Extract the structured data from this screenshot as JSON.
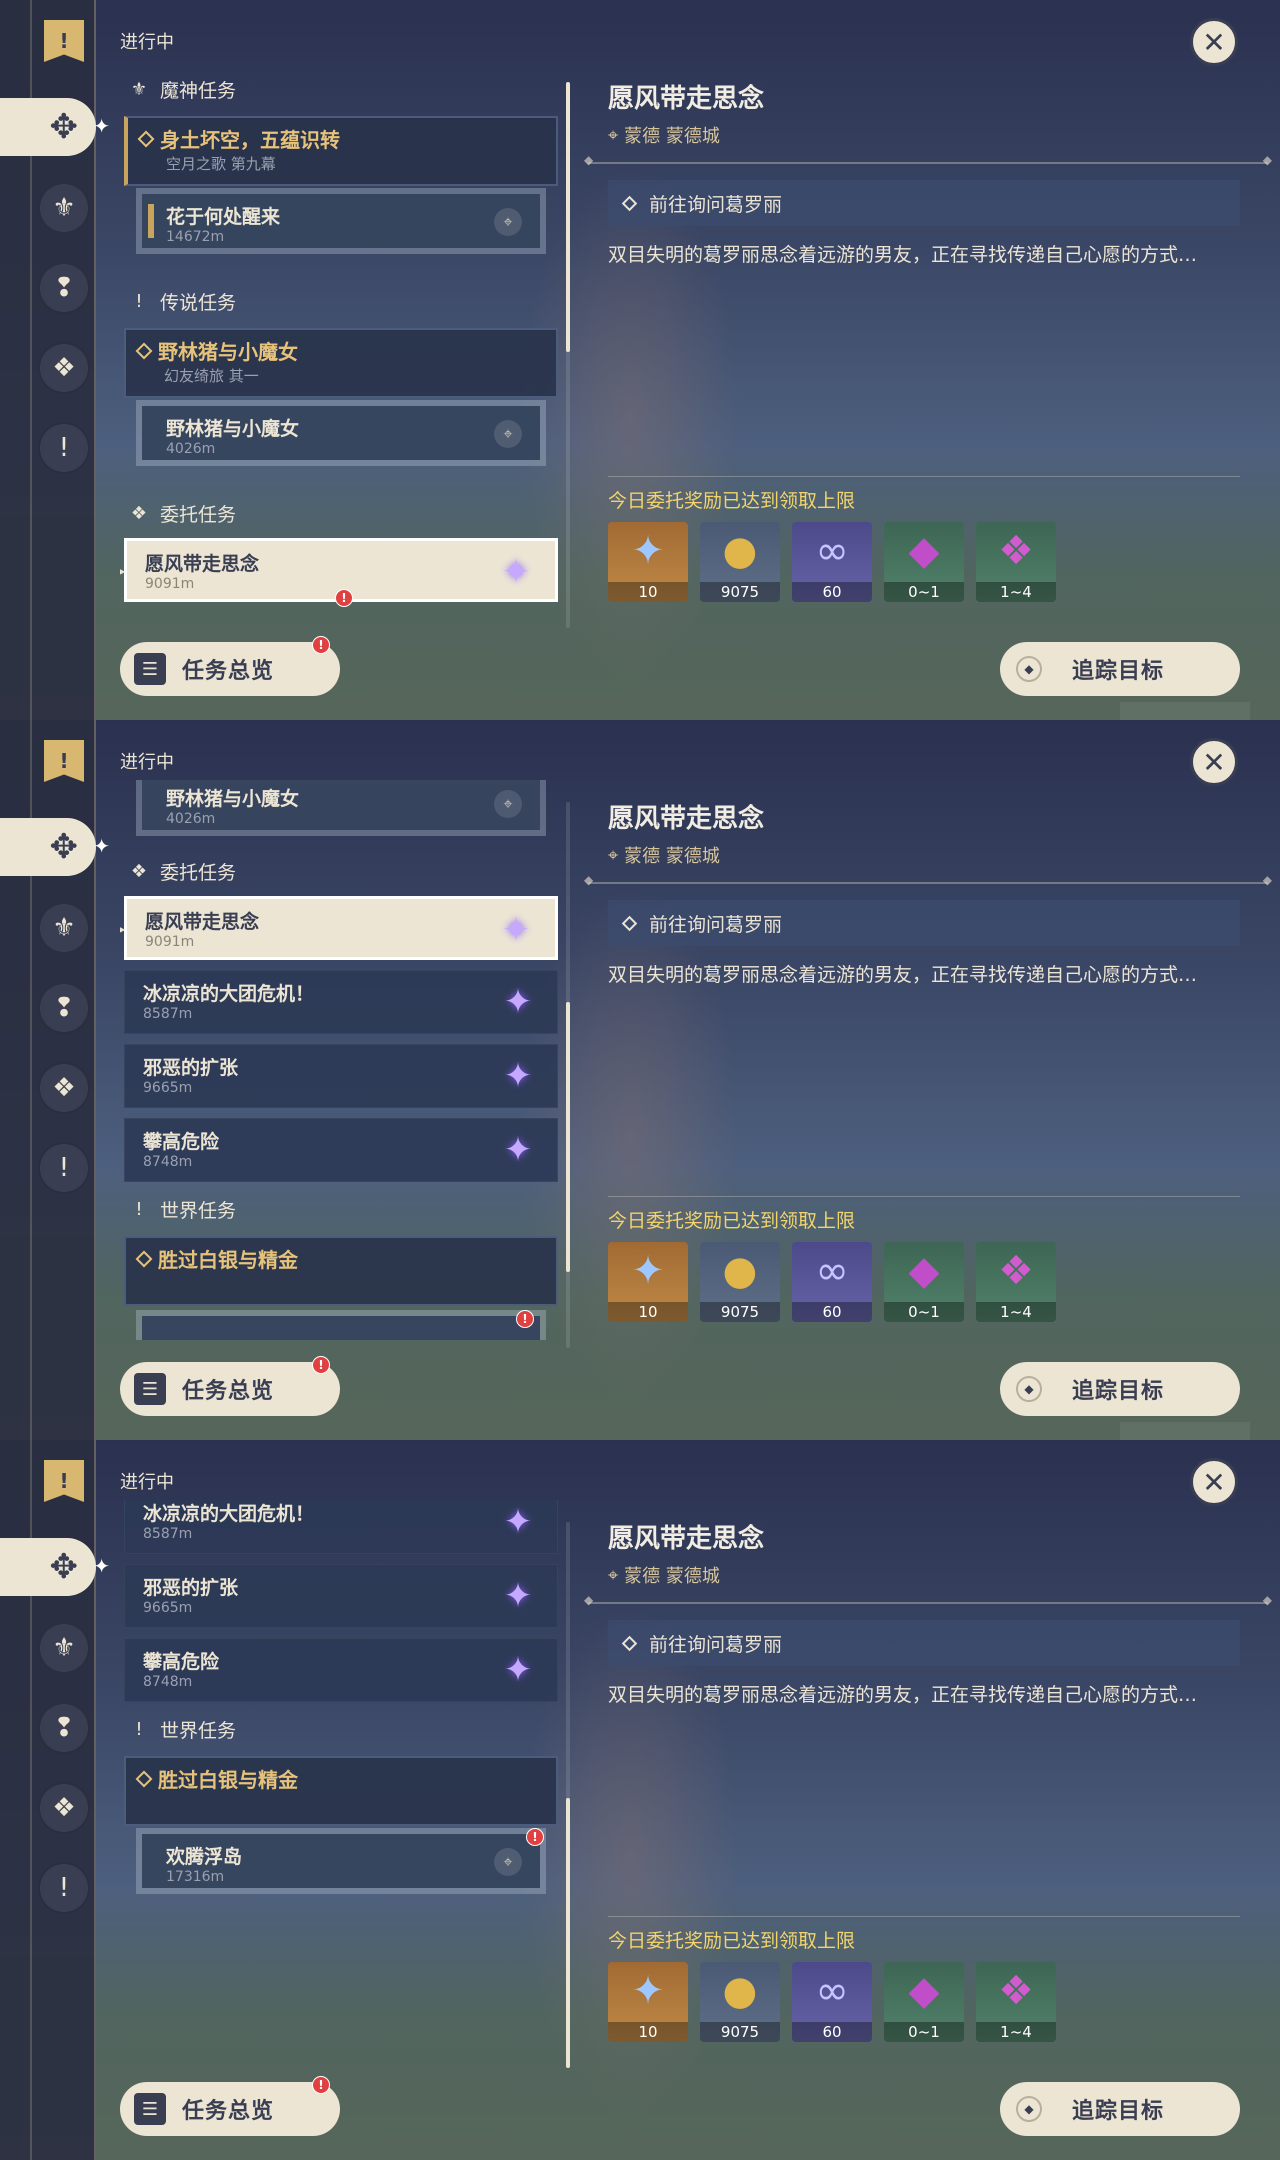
{
  "header": {
    "in_progress": "进行中"
  },
  "categories": {
    "archon": "魔神任务",
    "story": "传说任务",
    "commission": "委托任务",
    "world": "世界任务"
  },
  "quests": {
    "archon_title": "身土坏空，五蕴识转",
    "archon_sub": "空月之歌 第九幕",
    "archon_step": "花于何处醒来",
    "archon_step_dist": "14672m",
    "story_title": "野林猪与小魔女",
    "story_sub": "幻友绮旅 其一",
    "story_step": "野林猪与小魔女",
    "story_step_dist": "4026m",
    "world_title": "胜过白银与精金",
    "world_step": "欢腾浮岛",
    "world_step_dist": "17316m"
  },
  "commissions": [
    {
      "title": "愿风带走思念",
      "dist": "9091m"
    },
    {
      "title": "冰凉凉的大团危机！",
      "dist": "8587m"
    },
    {
      "title": "邪恶的扩张",
      "dist": "9665m"
    },
    {
      "title": "攀高危险",
      "dist": "8748m"
    }
  ],
  "buttons": {
    "overview": "任务总览",
    "track": "追踪目标"
  },
  "badge": "!",
  "detail": {
    "title": "愿风带走思念",
    "location": "蒙德 蒙德城",
    "step": "前往询问葛罗丽",
    "description": "双目失明的葛罗丽思念着远游的男友，正在寻找传递自己心愿的方式…",
    "limit_notice": "今日委托奖励已达到领取上限",
    "rewards": [
      {
        "icon": "primogem-icon",
        "count": "10"
      },
      {
        "icon": "mora-icon",
        "count": "9075"
      },
      {
        "icon": "friendship-exp-icon",
        "count": "60"
      },
      {
        "icon": "crystal-icon",
        "count": "0~1"
      },
      {
        "icon": "crystal-cluster-icon",
        "count": "1~4"
      }
    ]
  },
  "colors": {
    "accent_gold": "#e6c27a",
    "notice_yellow": "#f2d46a",
    "panel_cream": "#ece5d4",
    "badge_red": "#e04040"
  }
}
